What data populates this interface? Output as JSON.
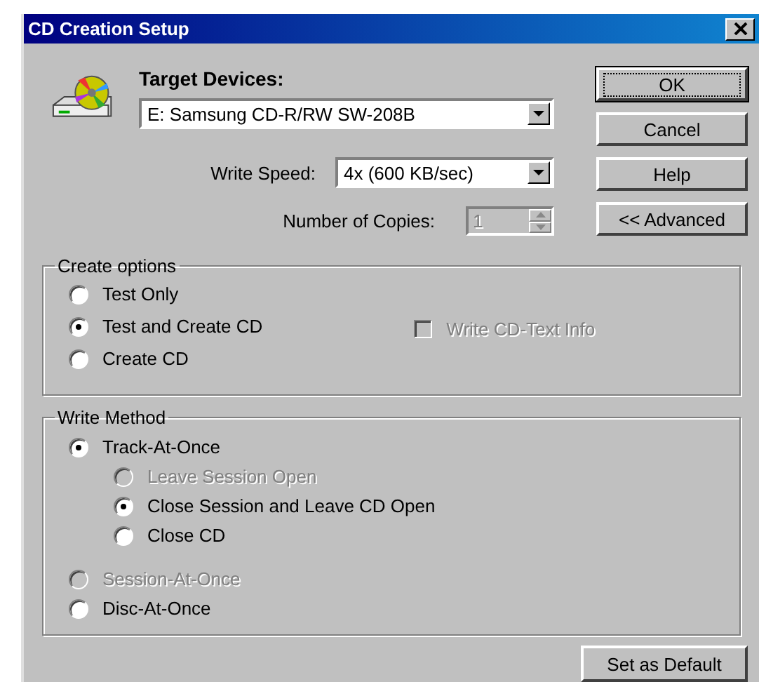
{
  "window": {
    "title": "CD Creation Setup"
  },
  "target_devices": {
    "label": "Target Devices:",
    "value": "E: Samsung CD-R/RW SW-208B"
  },
  "write_speed": {
    "label": "Write Speed:",
    "value": "4x (600 KB/sec)"
  },
  "copies": {
    "label": "Number of Copies:",
    "value": "1",
    "disabled": true
  },
  "buttons": [
    {
      "label": "OK",
      "default": true
    },
    {
      "label": "Cancel",
      "default": false
    },
    {
      "label": "Help",
      "default": false
    },
    {
      "label": "<< Advanced",
      "default": false
    }
  ],
  "create_options": {
    "title": "Create options",
    "options": [
      {
        "label": "Test Only",
        "selected": false,
        "disabled": false
      },
      {
        "label": "Test and Create CD",
        "selected": true,
        "disabled": false
      },
      {
        "label": "Create CD",
        "selected": false,
        "disabled": false
      }
    ],
    "checkbox": {
      "label": "Write CD-Text Info",
      "checked": false,
      "disabled": true
    }
  },
  "write_method": {
    "title": "Write Method",
    "options": [
      {
        "label": "Track-At-Once",
        "selected": true,
        "disabled": false,
        "children": [
          {
            "label": "Leave Session Open",
            "selected": false,
            "disabled": true
          },
          {
            "label": "Close Session and Leave CD Open",
            "selected": true,
            "disabled": false
          },
          {
            "label": "Close CD",
            "selected": false,
            "disabled": false
          }
        ]
      },
      {
        "label": "Session-At-Once",
        "selected": false,
        "disabled": true
      },
      {
        "label": "Disc-At-Once",
        "selected": false,
        "disabled": false
      }
    ]
  },
  "footer_button": {
    "label": "Set as Default"
  }
}
